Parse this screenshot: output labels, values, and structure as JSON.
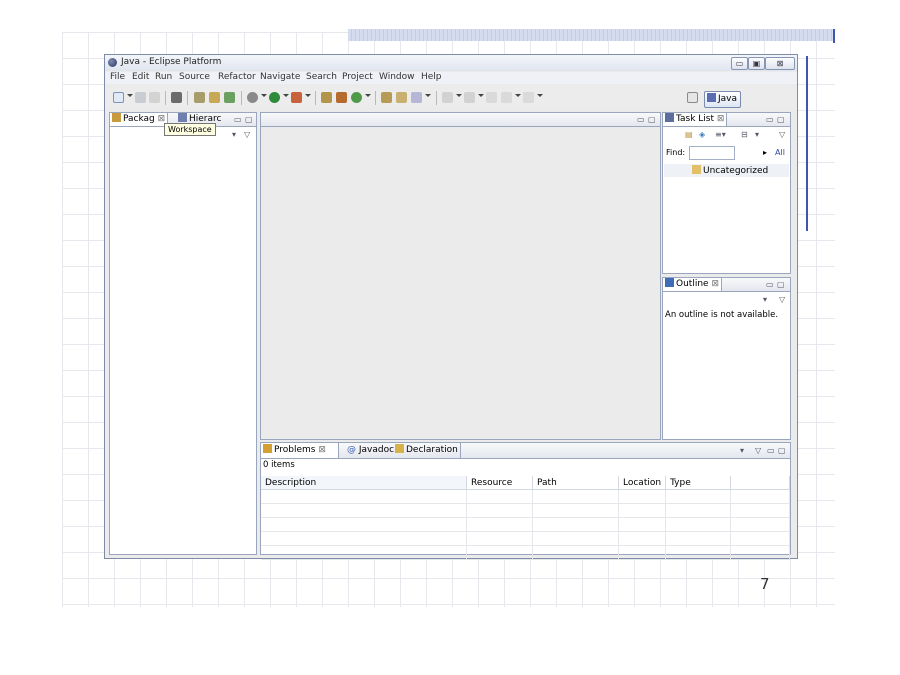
{
  "slide": {
    "page_number": "7"
  },
  "window": {
    "title": "Java - Eclipse Platform",
    "controls": [
      "▭",
      "▣",
      "⊠"
    ]
  },
  "menu": [
    "File",
    "Edit",
    "Run",
    "Source",
    "Refactor",
    "Navigate",
    "Search",
    "Project",
    "Window",
    "Help"
  ],
  "toolbar": {
    "perspective_label": "Java"
  },
  "left_panel": {
    "tabs": [
      "Packag",
      "Hierarc"
    ],
    "tooltip": "Workspace"
  },
  "task_list": {
    "tab": "Task List",
    "find_label": "Find:",
    "all_label": "All",
    "category": "Uncategorized"
  },
  "outline": {
    "tab": "Outline",
    "message": "An outline is not available."
  },
  "bottom_panel": {
    "tabs": [
      "Problems",
      "Javadoc",
      "Declaration"
    ],
    "status": "0 items",
    "columns": [
      "Description",
      "Resource",
      "Path",
      "Location",
      "Type"
    ]
  },
  "colors": {
    "accent": "#3e56b0",
    "panel_border": "#9aa6bd",
    "tooltip_bg": "#ffffe1"
  }
}
